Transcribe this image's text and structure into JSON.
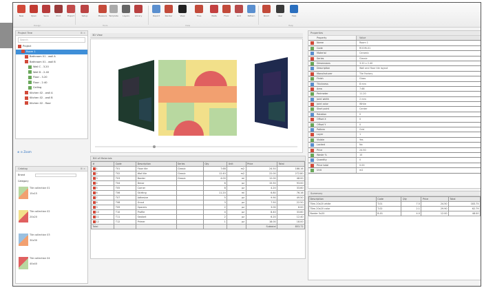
{
  "ribbon": {
    "buttons": [
      {
        "icon": "new-design-icon",
        "label": "New",
        "color": "#d24a3a"
      },
      {
        "icon": "open-design-icon",
        "label": "Open",
        "color": "#c23b32"
      },
      {
        "icon": "save-design-icon",
        "label": "Save",
        "color": "#b73b3b"
      },
      {
        "icon": "print-icon",
        "label": "Print",
        "color": "#9a3a3a"
      },
      {
        "icon": "export-icon",
        "label": "Export",
        "color": "#c24a4a"
      },
      {
        "icon": "settings-icon",
        "label": "Setup",
        "color": "#bb4444"
      },
      {
        "icon": "measure-icon",
        "label": "Measure",
        "color": "#c54a3a"
      },
      {
        "icon": "template-icon",
        "label": "Template",
        "color": "#aaaaaa"
      },
      {
        "icon": "layers-icon",
        "label": "Layers",
        "color": "#666666"
      },
      {
        "icon": "library-icon",
        "label": "Library",
        "color": "#b84040"
      },
      {
        "icon": "chart-icon",
        "label": "Report",
        "color": "#5a8fcf"
      },
      {
        "icon": "camera-icon",
        "label": "Render",
        "color": "#c24a3a"
      },
      {
        "icon": "display-icon",
        "label": "View",
        "color": "#222222"
      },
      {
        "icon": "tile-icon",
        "label": "Tiles",
        "color": "#c24a3a"
      },
      {
        "icon": "wall-icon",
        "label": "Walls",
        "color": "#c34040"
      },
      {
        "icon": "floor-icon",
        "label": "Floor",
        "color": "#c24a3a"
      },
      {
        "icon": "grid-icon",
        "label": "Grid",
        "color": "#b84a4a"
      },
      {
        "icon": "pattern-icon",
        "label": "Pattern",
        "color": "#5a8fcf"
      },
      {
        "icon": "room-icon",
        "label": "Room",
        "color": "#c24a3a"
      },
      {
        "icon": "user-icon",
        "label": "User",
        "color": "#3a3a3a"
      },
      {
        "icon": "help-icon",
        "label": "Help",
        "color": "#2a6fbf"
      }
    ],
    "groups": [
      "Design",
      "Tools",
      "View",
      "Help"
    ]
  },
  "tree_panel": {
    "title": "Project Tree",
    "search_placeholder": "Search",
    "rows": [
      {
        "label": "Project",
        "selected": false,
        "indent": 0
      },
      {
        "label": "Room 1",
        "selected": true,
        "indent": 1
      },
      {
        "label": "Bathroom 01 - wall A",
        "selected": false,
        "indent": 2
      },
      {
        "label": "Bathroom 01 - wall B",
        "selected": false,
        "indent": 2
      },
      {
        "label": "Wall C - 3.20",
        "selected": false,
        "indent": 3
      },
      {
        "label": "Wall D - 2.40",
        "selected": false,
        "indent": 3
      },
      {
        "label": "Floor - 3.20",
        "selected": false,
        "indent": 3
      },
      {
        "label": "Floor - 2.40",
        "selected": false,
        "indent": 3
      },
      {
        "label": "Ceiling",
        "selected": false,
        "indent": 3
      },
      {
        "label": "Kitchen 02 - wall A",
        "selected": false,
        "indent": 2
      },
      {
        "label": "Kitchen 02 - wall B",
        "selected": false,
        "indent": 2
      },
      {
        "label": "Kitchen 02 - floor",
        "selected": false,
        "indent": 2
      }
    ],
    "bottom_label": "Zoom"
  },
  "catalog_panel": {
    "title": "Catalog",
    "filter_label": "Brand",
    "category_label": "Category",
    "items": [
      {
        "name": "Tile collection 01",
        "code": "15x15"
      },
      {
        "name": "Tile collection 02",
        "code": "20x20"
      },
      {
        "name": "Tile collection 03",
        "code": "30x30"
      },
      {
        "name": "Tile collection 04",
        "code": "40x40"
      }
    ]
  },
  "viewport": {
    "title": "3D View"
  },
  "properties_panel": {
    "title": "Properties",
    "header": [
      "Property",
      "Value"
    ],
    "rows": [
      [
        "Name",
        "Room 1"
      ],
      [
        "Code",
        "ROOM-01"
      ],
      [
        "Material",
        "Ceramic"
      ],
      [
        "Series",
        "Classic"
      ],
      [
        "Dimensions",
        "3.20 x 2.40"
      ],
      [
        "Description",
        "Wall and floor tile layout"
      ],
      [
        "Manufacturer",
        "Tile Factory"
      ],
      [
        "Finish",
        "Gloss"
      ],
      [
        "Thickness",
        "8 mm"
      ],
      [
        "Area",
        "7.68"
      ],
      [
        "Perimeter",
        "11.20"
      ],
      [
        "Joint width",
        "2 mm"
      ],
      [
        "Joint color",
        "White"
      ],
      [
        "Start point",
        "Center"
      ],
      [
        "Rotation",
        "0"
      ],
      [
        "Offset X",
        "0"
      ],
      [
        "Offset Y",
        "0"
      ],
      [
        "Pattern",
        "Grid"
      ],
      [
        "Layer",
        "1"
      ],
      [
        "Visible",
        "Yes"
      ],
      [
        "Locked",
        "No"
      ],
      [
        "Price",
        "24.50"
      ],
      [
        "Waste %",
        "10"
      ],
      [
        "Quantity",
        "0"
      ],
      [
        "Price total",
        "0.00"
      ],
      [
        "Unit",
        "m2"
      ]
    ]
  },
  "summary_panel": {
    "title": "Summary",
    "header": [
      "Description",
      "Code",
      "Qty",
      "Price",
      "Total"
    ],
    "rows": [
      [
        "Tiles 20x20 white",
        "T-01",
        "7.5",
        "24.50",
        "183.75"
      ],
      [
        "Tiles 20x20 color",
        "T-02",
        "2.1",
        "29.90",
        "62.79"
      ],
      [
        "Border 5x20",
        "B-01",
        "4.0",
        "12.00",
        "48.00"
      ]
    ]
  },
  "bill_panel": {
    "title": "Bill of Materials",
    "header": [
      "#",
      "Code",
      "Description",
      "Series",
      "Qty",
      "Unit",
      "Price",
      "Total"
    ],
    "rows": [
      [
        "1",
        "T01",
        "Floor tile",
        "Classic",
        "7.68",
        "m2",
        "24.50",
        "188.16"
      ],
      [
        "2",
        "T02",
        "Wall tile",
        "Classic",
        "12.40",
        "m2",
        "22.00",
        "272.80"
      ],
      [
        "3",
        "T03",
        "Border",
        "Classic",
        "4.00",
        "ml",
        "12.00",
        "48.00"
      ],
      [
        "4",
        "T04",
        "Decor",
        "",
        "6",
        "pz",
        "15.50",
        "93.00"
      ],
      [
        "5",
        "T05",
        "Corner",
        "",
        "8",
        "pz",
        "4.20",
        "33.60"
      ],
      [
        "6",
        "T06",
        "Skirting",
        "",
        "11.20",
        "ml",
        "6.80",
        "76.16"
      ],
      [
        "7",
        "T07",
        "Adhesive",
        "",
        "5",
        "pz",
        "9.90",
        "49.50"
      ],
      [
        "8",
        "T08",
        "Grout",
        "",
        "3",
        "pz",
        "7.50",
        "22.50"
      ],
      [
        "9",
        "T09",
        "Spacers",
        "",
        "2",
        "pz",
        "3.00",
        "6.00"
      ],
      [
        "10",
        "T10",
        "Profile",
        "",
        "4",
        "pz",
        "8.40",
        "33.60"
      ],
      [
        "11",
        "T11",
        "Sealant",
        "",
        "2",
        "pz",
        "6.20",
        "12.40"
      ],
      [
        "12",
        "T12",
        "Primer",
        "",
        "1",
        "pz",
        "18.00",
        "18.00"
      ]
    ],
    "footer": [
      "Total",
      "",
      "",
      "",
      "",
      "",
      "Subtotal",
      "853.72"
    ]
  },
  "colors": {
    "selected": "#3f8fd8",
    "accent_red": "#d24a3a",
    "tile_orange": "#f2a070",
    "tile_green": "#b8d8a0",
    "tile_red": "#e06060",
    "tile_yellow": "#f2e08a"
  }
}
